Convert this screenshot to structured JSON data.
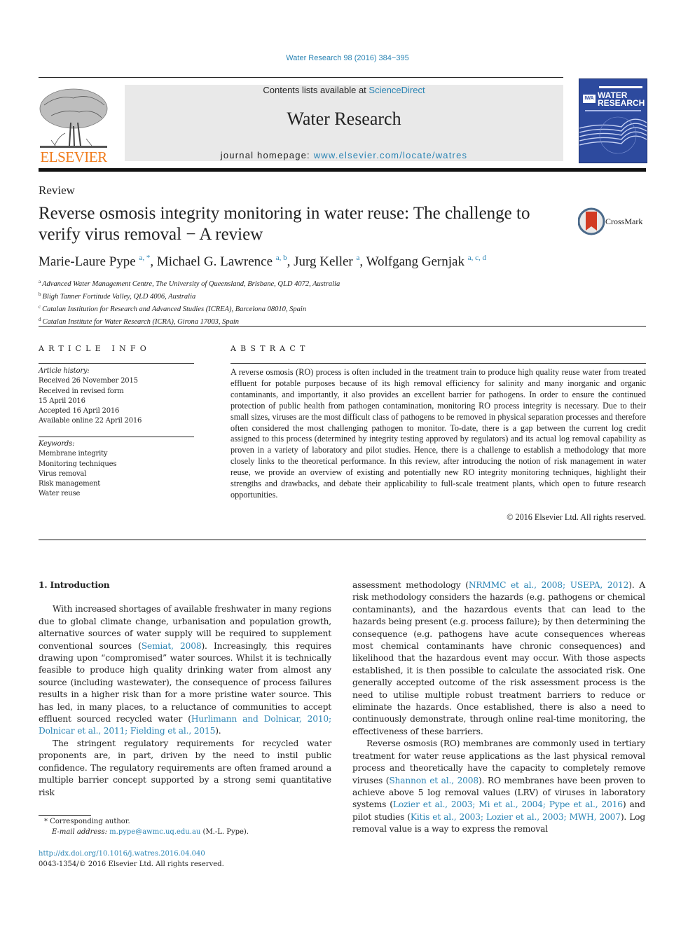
{
  "citation": "Water Research 98 (2016) 384−395",
  "header": {
    "publisher_wordmark": "ELSEVIER",
    "contents_prefix": "Contents lists available at ",
    "contents_link": "ScienceDirect",
    "journal_title": "Water Research",
    "homepage_prefix": "journal homepage: ",
    "homepage_link": "www.elsevier.com/locate/watres",
    "cover": {
      "badge": "IWA",
      "title_line1": "WATER",
      "title_line2": "RESEARCH",
      "color": "#2d4a9e"
    }
  },
  "article": {
    "type": "Review",
    "title": "Reverse osmosis integrity monitoring in water reuse: The challenge to verify virus removal − A review",
    "crossmark_label": "CrossMark",
    "authors": [
      {
        "name": "Marie-Laure Pype",
        "sup": "a, *"
      },
      {
        "name": "Michael G. Lawrence",
        "sup": "a, b"
      },
      {
        "name": "Jurg Keller",
        "sup": "a"
      },
      {
        "name": "Wolfgang Gernjak",
        "sup": "a, c, d"
      }
    ],
    "affiliations": [
      {
        "key": "a",
        "text": "Advanced Water Management Centre, The University of Queensland, Brisbane, QLD 4072, Australia"
      },
      {
        "key": "b",
        "text": "Bligh Tanner Fortitude Valley, QLD 4006, Australia"
      },
      {
        "key": "c",
        "text": "Catalan Institution for Research and Advanced Studies (ICREA), Barcelona 08010, Spain"
      },
      {
        "key": "d",
        "text": "Catalan Institute for Water Research (ICRA), Girona 17003, Spain"
      }
    ]
  },
  "article_info": {
    "heading": "ARTICLE INFO",
    "history_label": "Article history:",
    "history": [
      "Received 26 November 2015",
      "Received in revised form",
      "15 April 2016",
      "Accepted 16 April 2016",
      "Available online 22 April 2016"
    ],
    "keywords_label": "Keywords:",
    "keywords": [
      "Membrane integrity",
      "Monitoring techniques",
      "Virus removal",
      "Risk management",
      "Water reuse"
    ]
  },
  "abstract": {
    "heading": "ABSTRACT",
    "text": "A reverse osmosis (RO) process is often included in the treatment train to produce high quality reuse water from treated effluent for potable purposes because of its high removal efficiency for salinity and many inorganic and organic contaminants, and importantly, it also provides an excellent barrier for pathogens. In order to ensure the continued protection of public health from pathogen contamination, monitoring RO process integrity is necessary. Due to their small sizes, viruses are the most difficult class of pathogens to be removed in physical separation processes and therefore often considered the most challenging pathogen to monitor. To-date, there is a gap between the current log credit assigned to this process (determined by integrity testing approved by regulators) and its actual log removal capability as proven in a variety of laboratory and pilot studies. Hence, there is a challenge to establish a methodology that more closely links to the theoretical performance. In this review, after introducing the notion of risk management in water reuse, we provide an overview of existing and potentially new RO integrity monitoring techniques, highlight their strengths and drawbacks, and debate their applicability to full-scale treatment plants, which open to future research opportunities.",
    "copyright": "© 2016 Elsevier Ltd. All rights reserved."
  },
  "body": {
    "section_heading": "1.  Introduction",
    "left": {
      "p1": [
        {
          "t": "With increased shortages of available freshwater in many regions due to global climate change, urbanisation and population growth, alternative sources of water supply will be required to supplement conventional sources ("
        },
        {
          "t": "Semiat, 2008",
          "link": true
        },
        {
          "t": "). Increasingly, this requires drawing upon “compromised” water sources. Whilst it is technically feasible to produce high quality drinking water from almost any source (including wastewater), the consequence of process failures results in a higher risk than for a more pristine water source. This has led, in many places, to a reluctance of communities to accept effluent sourced recycled water ("
        },
        {
          "t": "Hurlimann and Dolnicar, 2010; Dolnicar et al., 2011; Fielding et al., 2015",
          "link": true
        },
        {
          "t": ")."
        }
      ],
      "p2": [
        {
          "t": "The stringent regulatory requirements for recycled water proponents are, in part, driven by the need to instil public confidence. The regulatory requirements are often framed around a multiple barrier concept supported by a strong semi quantitative risk"
        }
      ]
    },
    "right": {
      "p1": [
        {
          "t": "assessment methodology ("
        },
        {
          "t": "NRMMC et al., 2008; USEPA, 2012",
          "link": true
        },
        {
          "t": "). A risk methodology considers the hazards (e.g. pathogens or chemical contaminants), and the hazardous events that can lead to the hazards being present (e.g. process failure); by then determining the consequence (e.g. pathogens have acute consequences whereas most chemical contaminants have chronic consequences) and likelihood that the hazardous event may occur. With those aspects established, it is then possible to calculate the associated risk. One generally accepted outcome of the risk assessment process is the need to utilise multiple robust treatment barriers to reduce or eliminate the hazards. Once established, there is also a need to continuously demonstrate, through online real-time monitoring, the effectiveness of these barriers."
        }
      ],
      "p2": [
        {
          "t": "Reverse osmosis (RO) membranes are commonly used in tertiary treatment for water reuse applications as the last physical removal process and theoretically have the capacity to completely remove viruses ("
        },
        {
          "t": "Shannon et al., 2008",
          "link": true
        },
        {
          "t": "). RO membranes have been proven to achieve above 5 log removal values (LRV) of viruses in laboratory systems ("
        },
        {
          "t": "Lozier et al., 2003; Mi et al., 2004; Pype et al., 2016",
          "link": true
        },
        {
          "t": ") and pilot studies ("
        },
        {
          "t": "Kitis et al., 2003; Lozier et al., 2003; MWH, 2007",
          "link": true
        },
        {
          "t": "). Log removal value is a way to express the removal"
        }
      ]
    }
  },
  "footnotes": {
    "corresponding": "* Corresponding author.",
    "email_label": "E-mail address: ",
    "email": "m.pype@awmc.uq.edu.au",
    "email_suffix": " (M.-L. Pype).",
    "doi": "http://dx.doi.org/10.1016/j.watres.2016.04.040",
    "issn_line": "0043-1354/© 2016 Elsevier Ltd. All rights reserved."
  },
  "colors": {
    "link": "#2a84b4",
    "elsevier_orange": "#f07c1c",
    "header_box": "#e9e9e9"
  }
}
